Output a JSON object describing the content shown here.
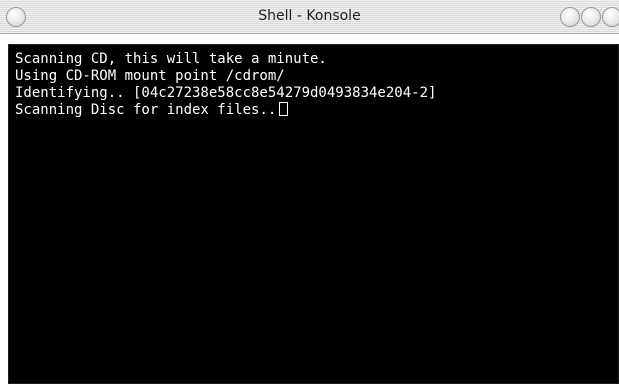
{
  "window": {
    "title": "Shell - Konsole"
  },
  "terminal": {
    "lines": [
      "Scanning CD, this will take a minute.",
      "Using CD-ROM mount point /cdrom/",
      "Identifying.. [04c27238e58cc8e54279d0493834e204-2]",
      "Scanning Disc for index files.."
    ],
    "cursor_icon": "block-cursor"
  },
  "colors": {
    "terminal_background": "#000000",
    "terminal_foreground": "#ffffff",
    "titlebar": "#e0e0e0"
  }
}
